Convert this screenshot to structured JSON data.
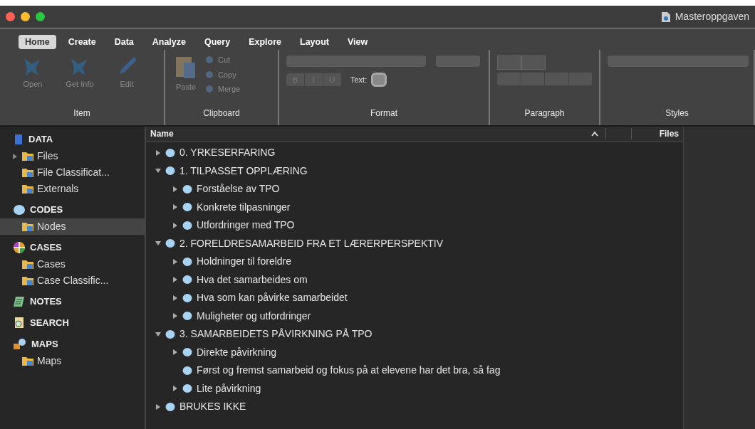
{
  "window": {
    "title": "Masteroppgaven"
  },
  "ribbon_tabs": [
    {
      "label": "Home",
      "selected": true
    },
    {
      "label": "Create",
      "selected": false
    },
    {
      "label": "Data",
      "selected": false
    },
    {
      "label": "Analyze",
      "selected": false
    },
    {
      "label": "Query",
      "selected": false
    },
    {
      "label": "Explore",
      "selected": false
    },
    {
      "label": "Layout",
      "selected": false
    },
    {
      "label": "View",
      "selected": false
    }
  ],
  "ribbon_groups": [
    {
      "label": "Item",
      "kind": "item",
      "buttons": [
        {
          "label": "Open",
          "disabled": true
        },
        {
          "label": "Get Info",
          "disabled": true
        },
        {
          "label": "Edit",
          "disabled": true
        }
      ]
    },
    {
      "label": "Clipboard",
      "kind": "clipboard",
      "buttons": [
        {
          "label": "Paste",
          "disabled": true
        },
        {
          "label": "Cut",
          "disabled": true
        },
        {
          "label": "Copy",
          "disabled": true
        },
        {
          "label": "Merge",
          "disabled": true
        }
      ]
    },
    {
      "label": "Format",
      "kind": "format",
      "buttons": [
        {
          "label": "B",
          "disabled": true
        },
        {
          "label": "I",
          "disabled": true
        },
        {
          "label": "U",
          "disabled": true
        }
      ],
      "text_label": "Text:"
    },
    {
      "label": "Paragraph",
      "kind": "paragraph"
    },
    {
      "label": "Styles",
      "kind": "styles"
    }
  ],
  "sidebar": [
    {
      "label": "DATA",
      "kind": "data",
      "items": [
        {
          "label": "Files",
          "selected": false,
          "expandable": true
        },
        {
          "label": "File Classificat...",
          "selected": false,
          "expandable": false
        },
        {
          "label": "Externals",
          "selected": false,
          "expandable": false
        }
      ]
    },
    {
      "label": "CODES",
      "kind": "codes",
      "items": [
        {
          "label": "Nodes",
          "selected": true,
          "expandable": false
        }
      ]
    },
    {
      "label": "CASES",
      "kind": "cases",
      "items": [
        {
          "label": "Cases",
          "selected": false,
          "expandable": false
        },
        {
          "label": "Case Classific...",
          "selected": false,
          "expandable": false
        }
      ]
    },
    {
      "label": "NOTES",
      "kind": "notes"
    },
    {
      "label": "SEARCH",
      "kind": "search"
    },
    {
      "label": "MAPS",
      "kind": "maps",
      "items": [
        {
          "label": "Maps",
          "selected": false,
          "expandable": false
        }
      ]
    }
  ],
  "table": {
    "columns": [
      "Name",
      "Files"
    ],
    "rows": [
      {
        "name": "0. YRKESERFARING",
        "expanded": false
      },
      {
        "name": "1. TILPASSET OPPLÆRING",
        "expanded": true,
        "children": [
          {
            "name": "Forståelse av TPO",
            "expanded": false
          },
          {
            "name": "Konkrete tilpasninger",
            "expanded": false
          },
          {
            "name": "Utfordringer med TPO",
            "expanded": false
          }
        ]
      },
      {
        "name": "2. FORELDRESAMARBEID FRA ET LÆRERPERSPEKTIV",
        "expanded": true,
        "children": [
          {
            "name": "Holdninger til foreldre",
            "expanded": false
          },
          {
            "name": "Hva det samarbeides om",
            "expanded": false
          },
          {
            "name": "Hva som kan påvirke samarbeidet",
            "expanded": false
          },
          {
            "name": "Muligheter og utfordringer",
            "expanded": false
          }
        ]
      },
      {
        "name": "3. SAMARBEIDETS PÅVIRKNING PÅ TPO",
        "expanded": true,
        "children": [
          {
            "name": "Direkte påvirkning",
            "expanded": false
          },
          {
            "name": "Først og fremst samarbeid og fokus på at elevene har det bra, så fag"
          },
          {
            "name": "Lite påvirkning",
            "expanded": false
          }
        ]
      },
      {
        "name": "BRUKES IKKE",
        "expanded": false
      }
    ]
  }
}
